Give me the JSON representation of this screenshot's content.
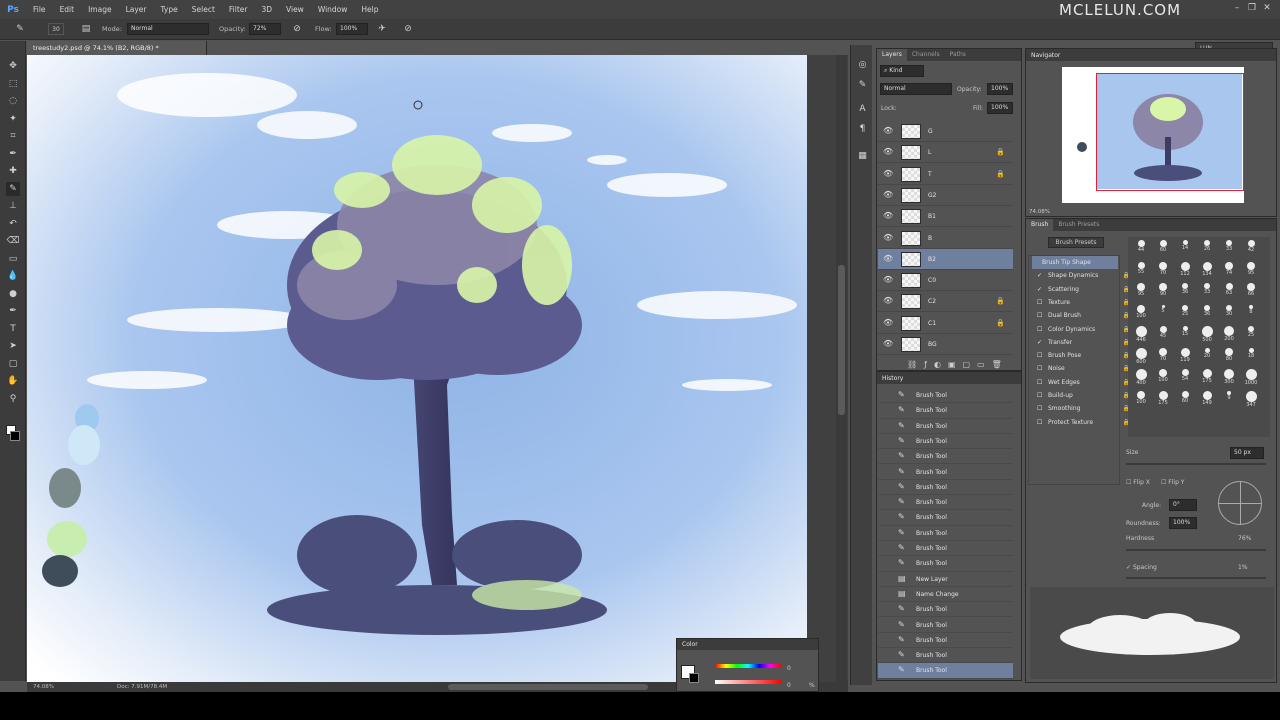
{
  "app": {
    "logo": "Ps",
    "watermark": "MCLELUN.COM",
    "workspace": "LUN"
  },
  "menu": [
    "File",
    "Edit",
    "Image",
    "Layer",
    "Type",
    "Select",
    "Filter",
    "3D",
    "View",
    "Window",
    "Help"
  ],
  "window_controls": [
    "–",
    "❐",
    "✕"
  ],
  "options": {
    "brush_size": "30",
    "mode_label": "Mode:",
    "mode_value": "Normal",
    "opacity_label": "Opacity:",
    "opacity_value": "72%",
    "flow_label": "Flow:",
    "flow_value": "100%"
  },
  "document": {
    "tab_title": "treestudy2.psd @ 74.1% (B2, RGB/8) *",
    "zoom": "74.08%",
    "doc_size": "Doc: 7.91M/78.4M"
  },
  "layers_panel": {
    "tabs": [
      "Layers",
      "Channels",
      "Paths"
    ],
    "kind": "⌕ Kind",
    "blend_mode": "Normal",
    "opacity_label": "Opacity:",
    "opacity": "100%",
    "lock_label": "Lock:",
    "fill_label": "Fill:",
    "fill": "100%",
    "layers": [
      {
        "name": "G",
        "locked": false,
        "selected": false
      },
      {
        "name": "L",
        "locked": true,
        "selected": false
      },
      {
        "name": "T",
        "locked": true,
        "selected": false
      },
      {
        "name": "G2",
        "locked": false,
        "selected": false
      },
      {
        "name": "B1",
        "locked": false,
        "selected": false
      },
      {
        "name": "B",
        "locked": false,
        "selected": false
      },
      {
        "name": "B2",
        "locked": false,
        "selected": true
      },
      {
        "name": "C0",
        "locked": false,
        "selected": false
      },
      {
        "name": "C2",
        "locked": true,
        "selected": false
      },
      {
        "name": "C1",
        "locked": true,
        "selected": false
      },
      {
        "name": "BG",
        "locked": false,
        "selected": false
      }
    ]
  },
  "history_panel": {
    "title": "History",
    "items": [
      {
        "name": "Brush Tool",
        "icon": "brush"
      },
      {
        "name": "Brush Tool",
        "icon": "brush"
      },
      {
        "name": "Brush Tool",
        "icon": "brush"
      },
      {
        "name": "Brush Tool",
        "icon": "brush"
      },
      {
        "name": "Brush Tool",
        "icon": "brush"
      },
      {
        "name": "Brush Tool",
        "icon": "brush"
      },
      {
        "name": "Brush Tool",
        "icon": "brush"
      },
      {
        "name": "Brush Tool",
        "icon": "brush"
      },
      {
        "name": "Brush Tool",
        "icon": "brush"
      },
      {
        "name": "Brush Tool",
        "icon": "brush"
      },
      {
        "name": "Brush Tool",
        "icon": "brush"
      },
      {
        "name": "Brush Tool",
        "icon": "brush"
      },
      {
        "name": "New Layer",
        "icon": "layer"
      },
      {
        "name": "Name Change",
        "icon": "layer"
      },
      {
        "name": "Brush Tool",
        "icon": "brush"
      },
      {
        "name": "Brush Tool",
        "icon": "brush"
      },
      {
        "name": "Brush Tool",
        "icon": "brush"
      },
      {
        "name": "Brush Tool",
        "icon": "brush"
      },
      {
        "name": "Brush Tool",
        "icon": "brush"
      }
    ],
    "selected_index": 18
  },
  "navigator": {
    "title": "Navigator",
    "zoom": "74.08%"
  },
  "brush_panel": {
    "tabs": [
      "Brush",
      "Brush Presets"
    ],
    "presets_button": "Brush Presets",
    "options": [
      {
        "name": "Brush Tip Shape",
        "checked": false,
        "active": true
      },
      {
        "name": "Shape Dynamics",
        "checked": true,
        "active": false
      },
      {
        "name": "Scattering",
        "checked": true,
        "active": false
      },
      {
        "name": "Texture",
        "checked": false,
        "active": false
      },
      {
        "name": "Dual Brush",
        "checked": false,
        "active": false
      },
      {
        "name": "Color Dynamics",
        "checked": false,
        "active": false
      },
      {
        "name": "Transfer",
        "checked": true,
        "active": false
      },
      {
        "name": "Brush Pose",
        "checked": false,
        "active": false
      },
      {
        "name": "Noise",
        "checked": false,
        "active": false
      },
      {
        "name": "Wet Edges",
        "checked": false,
        "active": false
      },
      {
        "name": "Build-up",
        "checked": false,
        "active": false
      },
      {
        "name": "Smoothing",
        "checked": false,
        "active": false
      },
      {
        "name": "Protect Texture",
        "checked": false,
        "active": false
      }
    ],
    "tip_sizes": [
      "44",
      "60",
      "14",
      "26",
      "33",
      "42",
      "55",
      "70",
      "112",
      "134",
      "74",
      "95",
      "95",
      "90",
      "36",
      "33",
      "63",
      "66",
      "100",
      "5",
      "25",
      "36",
      "30",
      "8",
      "446",
      "45",
      "15",
      "500",
      "200",
      "25",
      "600",
      "70",
      "119",
      "20",
      "80",
      "18",
      "400",
      "100",
      "54",
      "175",
      "300",
      "1000",
      "100",
      "175",
      "60",
      "149",
      "9",
      "347"
    ],
    "size_label": "Size",
    "size_value": "50 px",
    "flip_x": "Flip X",
    "flip_y": "Flip Y",
    "angle_label": "Angle:",
    "angle_value": "0°",
    "roundness_label": "Roundness:",
    "roundness_value": "100%",
    "hardness_label": "Hardness",
    "hardness_value": "76%",
    "spacing_label": "Spacing",
    "spacing_value": "1%"
  },
  "color_panel": {
    "title": "Color",
    "h_value": "0",
    "s_value": "0",
    "percent": "%"
  },
  "colors": {
    "accent": "#6f7f9e",
    "panel_bg": "#535353",
    "dark_bg": "#3c3c3c"
  }
}
